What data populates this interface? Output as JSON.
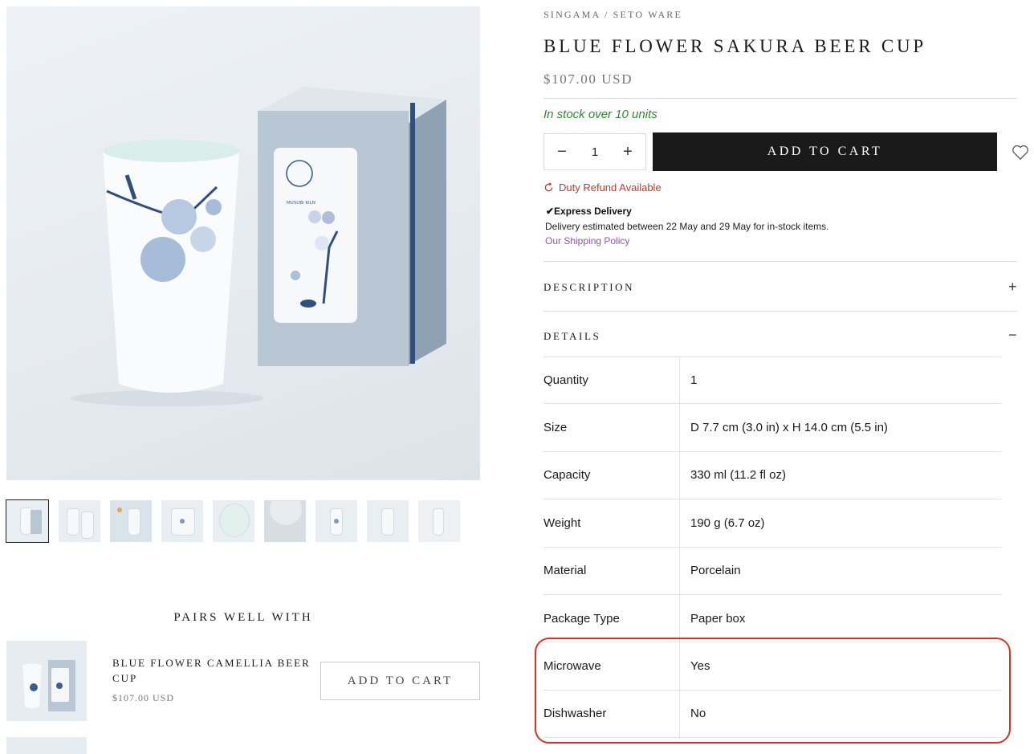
{
  "product": {
    "breadcrumb": "SINGAMA / SETO WARE",
    "title": "BLUE FLOWER SAKURA BEER CUP",
    "price": "$107.00 USD",
    "stock_text": "In stock over 10 units",
    "quantity": "1",
    "add_to_cart_label": "ADD TO CART",
    "duty_text": "Duty Refund Available",
    "express_title": "✔Express Delivery",
    "express_text": "Delivery estimated between 22 May and 29 May for in-stock items.",
    "shipping_policy_link": "Our Shipping Policy"
  },
  "box_label": "MUSUBI KILN",
  "accordions": [
    {
      "label": "DESCRIPTION",
      "toggle": "+"
    },
    {
      "label": "DETAILS",
      "toggle": "−"
    }
  ],
  "details": [
    {
      "label": "Quantity",
      "value": "1"
    },
    {
      "label": "Size",
      "value": "D 7.7 cm (3.0 in) x H 14.0 cm (5.5 in)"
    },
    {
      "label": "Capacity",
      "value": "330 ml (11.2 fl oz)"
    },
    {
      "label": "Weight",
      "value": "190 g (6.7 oz)"
    },
    {
      "label": "Material",
      "value": "Porcelain"
    },
    {
      "label": "Package Type",
      "value": "Paper box"
    },
    {
      "label": "Microwave",
      "value": "Yes"
    },
    {
      "label": "Dishwasher",
      "value": "No"
    }
  ],
  "pairs": {
    "title": "PAIRS WELL WITH",
    "items": [
      {
        "name": "BLUE FLOWER CAMELLIA BEER CUP",
        "price": "$107.00 USD",
        "button": "ADD TO CART"
      }
    ]
  },
  "colors": {
    "accent_dark": "#1a1a1a",
    "stock_green": "#2f8a2f",
    "duty_red": "#c0392b",
    "link_purple": "#9b4fb3",
    "highlight_red": "#e0301e"
  },
  "icons": {
    "wishlist": "heart-icon",
    "decrease": "minus-icon",
    "increase": "plus-icon",
    "duty": "refresh-icon"
  }
}
